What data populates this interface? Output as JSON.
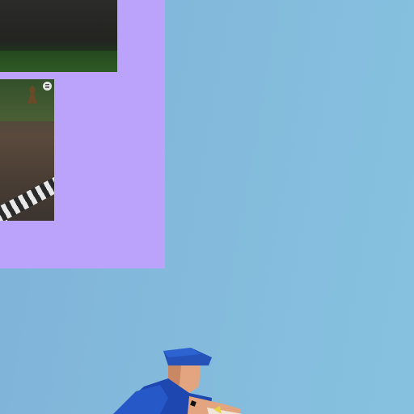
{
  "background": {
    "color": "#84bbdc"
  },
  "panel": {
    "color": "#bba2fb"
  },
  "thumbnails": [
    {
      "id": "top-thumbnail"
    },
    {
      "id": "main-thumbnail"
    }
  ],
  "controls": {
    "menu_icon": "menu-icon",
    "scroll_up_icon": "chevron-up-icon",
    "scroll_down_icon": "chevron-down-icon"
  },
  "scene": {
    "character": "blue-uniform-character"
  }
}
